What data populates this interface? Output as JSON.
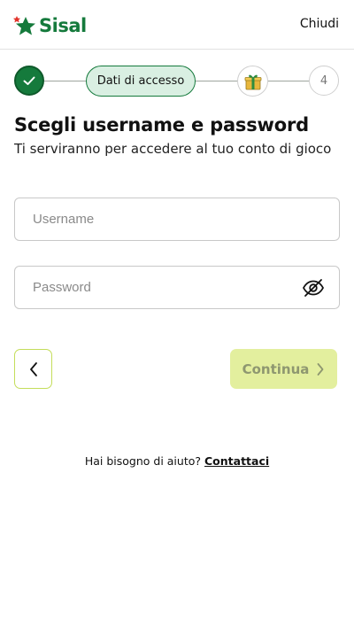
{
  "header": {
    "logo_text": "Sisal",
    "close_label": "Chiudi"
  },
  "stepper": {
    "active_step_label": "Dati di accesso",
    "last_step_number": "4",
    "gift_icon": "gift-icon",
    "done_icon": "check-icon"
  },
  "form": {
    "title": "Scegli username e password",
    "subtitle": "Ti serviranno per accedere al tuo conto di gioco",
    "username_placeholder": "Username",
    "password_placeholder": "Password",
    "username_value": "",
    "password_value": ""
  },
  "actions": {
    "back_icon": "chevron-left-icon",
    "continue_label": "Continua",
    "continue_icon": "chevron-right-icon"
  },
  "help": {
    "question": "Hai bisogno di aiuto?",
    "link_label": "Contattaci"
  },
  "colors": {
    "brand_green": "#157a3c",
    "active_step_bg": "#d9efe2",
    "continue_bg_disabled": "#e3ef9e",
    "back_border": "#c4dd5a",
    "brand_red": "#e2342b"
  }
}
